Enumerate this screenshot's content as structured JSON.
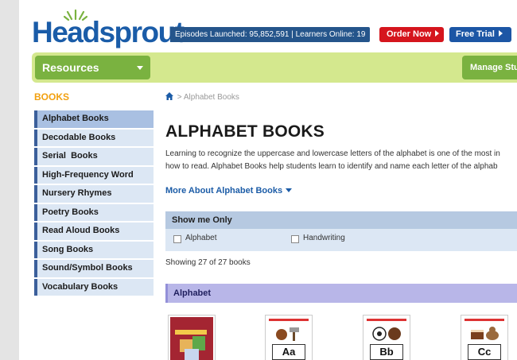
{
  "header": {
    "logo_text": "Headsprout",
    "stats": "Episodes Launched: 95,852,591 | Learners Online: 19",
    "order_now": "Order Now",
    "free_trial": "Free Trial"
  },
  "nav": {
    "resources": "Resources",
    "manage": "Manage Stud"
  },
  "sidebar": {
    "heading": "BOOKS",
    "items": [
      {
        "label": "Alphabet Books"
      },
      {
        "label": "Decodable Books"
      },
      {
        "label": "Serial  Books"
      },
      {
        "label": "High-Frequency Word"
      },
      {
        "label": "Nursery Rhymes"
      },
      {
        "label": "Poetry Books"
      },
      {
        "label": "Read Aloud Books"
      },
      {
        "label": "Song Books"
      },
      {
        "label": "Sound/Symbol Books"
      },
      {
        "label": "Vocabulary Books"
      }
    ]
  },
  "main": {
    "breadcrumb_sep": ">",
    "breadcrumb": "Alphabet Books",
    "title": "ALPHABET BOOKS",
    "desc_line1": "Learning to recognize the uppercase and lowercase letters of the alphabet is one of the most in",
    "desc_line2": "how to read. Alphabet Books help students learn to identify and name each letter of the alphab",
    "more_link": "More About Alphabet Books",
    "filter": {
      "heading": "Show me Only",
      "options": [
        "Alphabet",
        "Handwriting"
      ]
    },
    "showing": "Showing 27 of 27 books",
    "section": "Alphabet",
    "books": [
      {
        "letter": ""
      },
      {
        "letter": "Aa"
      },
      {
        "letter": "Bb"
      },
      {
        "letter": "Cc"
      }
    ]
  },
  "colors": {
    "brand_blue": "#1a5ca8",
    "order_red": "#d5151d",
    "nav_green": "#7ab240",
    "nav_bar": "#d4e88e",
    "books_orange": "#f2a00f"
  }
}
